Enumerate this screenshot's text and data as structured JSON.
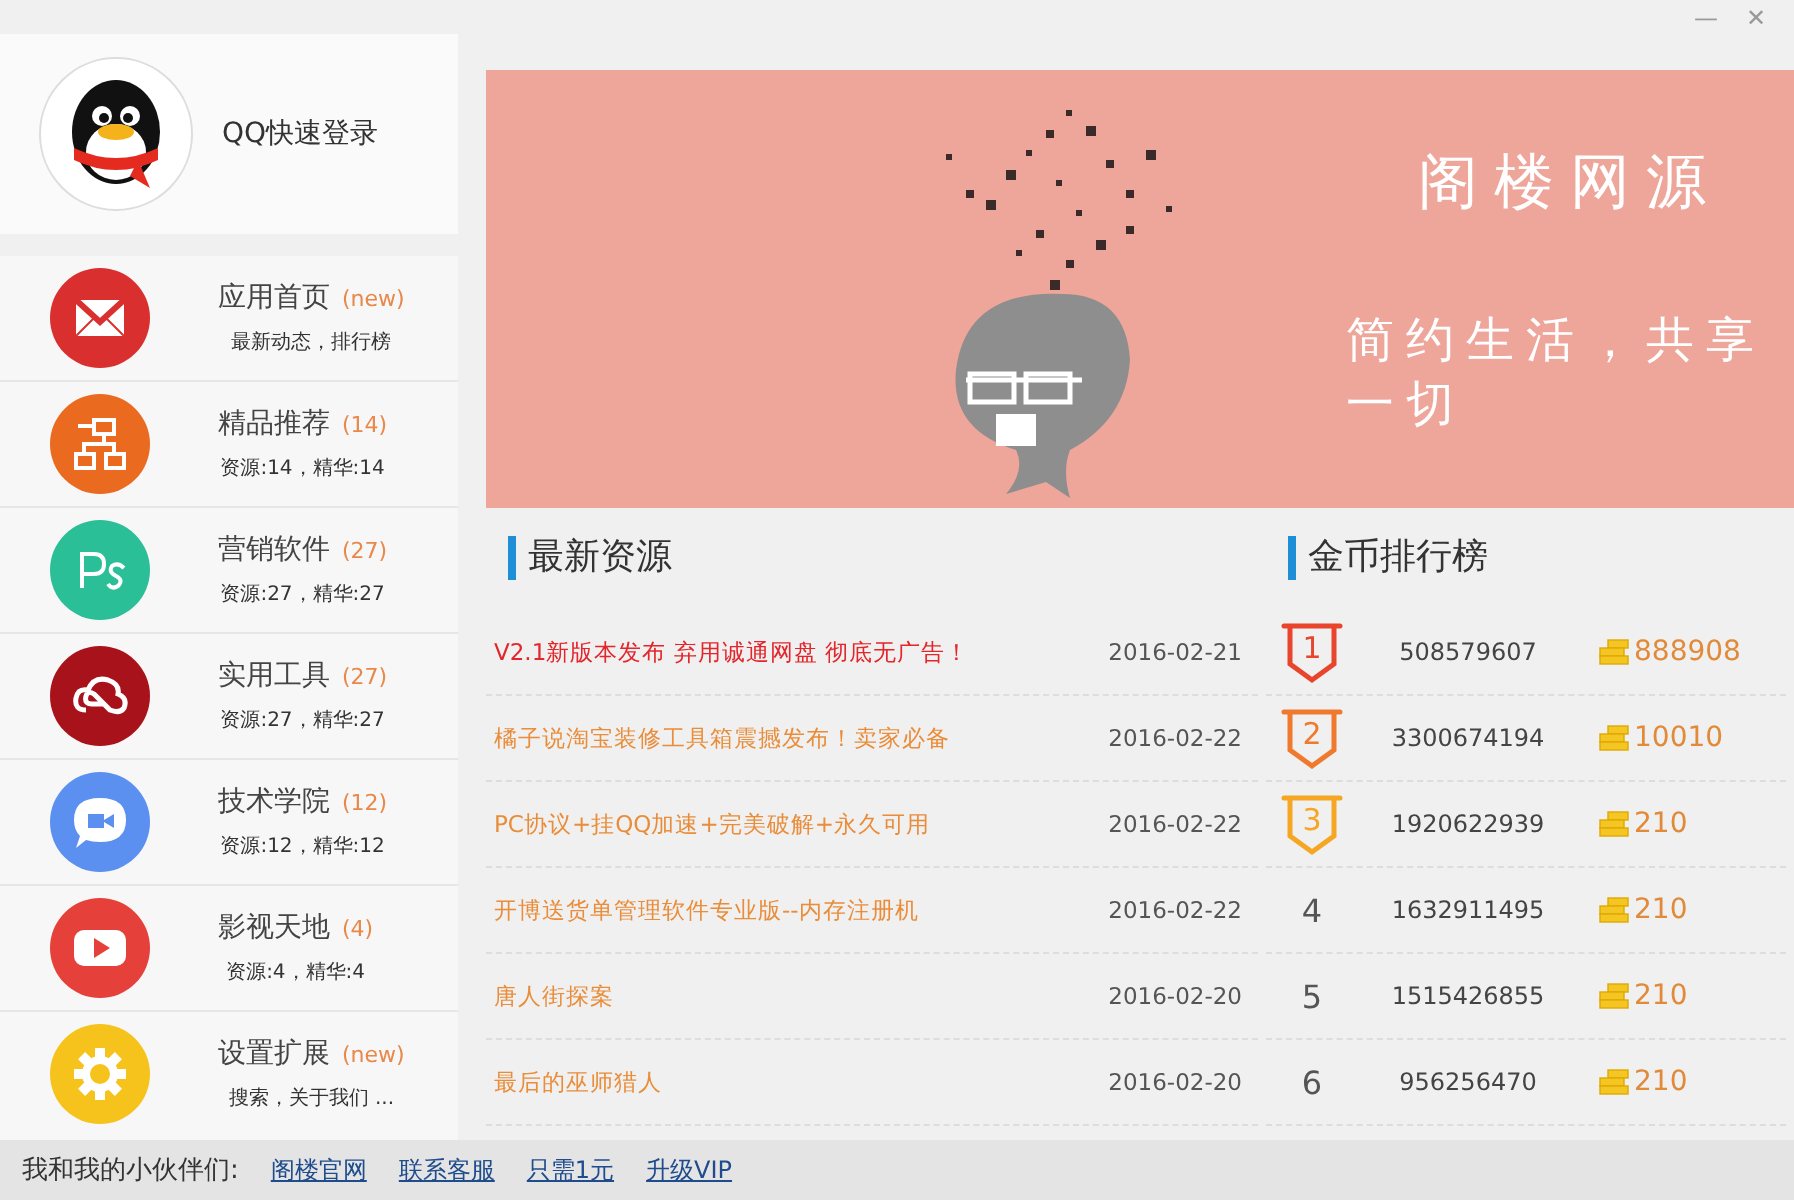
{
  "window": {
    "minimize": "—",
    "close": "✕"
  },
  "login": {
    "label": "QQ快速登录"
  },
  "sidebar": {
    "items": [
      {
        "title": "应用首页",
        "count": "(new)",
        "detail": "最新动态，排行榜",
        "color": "#d9302f"
      },
      {
        "title": "精品推荐",
        "count": "(14)",
        "detail": "资源:14，精华:14",
        "color": "#ea6a1f"
      },
      {
        "title": "营销软件",
        "count": "(27)",
        "detail": "资源:27，精华:27",
        "color": "#2bbf98"
      },
      {
        "title": "实用工具",
        "count": "(27)",
        "detail": "资源:27，精华:27",
        "color": "#a8131b"
      },
      {
        "title": "技术学院",
        "count": "(12)",
        "detail": "资源:12，精华:12",
        "color": "#5b8ff0"
      },
      {
        "title": "影视天地",
        "count": "(4)",
        "detail": "资源:4，精华:4",
        "color": "#e5403a"
      },
      {
        "title": "设置扩展",
        "count": "(new)",
        "detail": "搜索，关于我们 ...",
        "color": "#f6c21c"
      }
    ]
  },
  "banner": {
    "title": "阁楼网源",
    "subtitle": "简约生活，共享一切"
  },
  "news": {
    "heading": "最新资源",
    "items": [
      {
        "title": "V2.1新版本发布 弃用诚通网盘 彻底无广告！",
        "date": "2016-02-21",
        "highlighted": true
      },
      {
        "title": "橘子说淘宝装修工具箱震撼发布！卖家必备",
        "date": "2016-02-22",
        "highlighted": false
      },
      {
        "title": "PC协议+挂QQ加速+完美破解+永久可用",
        "date": "2016-02-22",
        "highlighted": false
      },
      {
        "title": "开博送货单管理软件专业版--内存注册机",
        "date": "2016-02-22",
        "highlighted": false
      },
      {
        "title": "唐人街探案",
        "date": "2016-02-20",
        "highlighted": false
      },
      {
        "title": "最后的巫师猎人",
        "date": "2016-02-20",
        "highlighted": false
      }
    ]
  },
  "ranking": {
    "heading": "金币排行榜",
    "rows": [
      {
        "rank": "1",
        "kind": "medal",
        "color": "#e8452c",
        "user": "508579607",
        "coins": "888908"
      },
      {
        "rank": "2",
        "kind": "medal",
        "color": "#ef7a2e",
        "user": "3300674194",
        "coins": "10010"
      },
      {
        "rank": "3",
        "kind": "medal",
        "color": "#f5a623",
        "user": "1920622939",
        "coins": "210"
      },
      {
        "rank": "4",
        "kind": "plain",
        "user": "1632911495",
        "coins": "210"
      },
      {
        "rank": "5",
        "kind": "plain",
        "user": "1515426855",
        "coins": "210"
      },
      {
        "rank": "6",
        "kind": "plain",
        "user": "956256470",
        "coins": "210"
      }
    ]
  },
  "footer": {
    "label": "我和我的小伙伴们:",
    "links": [
      "阁楼官网",
      "联系客服",
      "只需1元",
      "升级VIP"
    ]
  }
}
